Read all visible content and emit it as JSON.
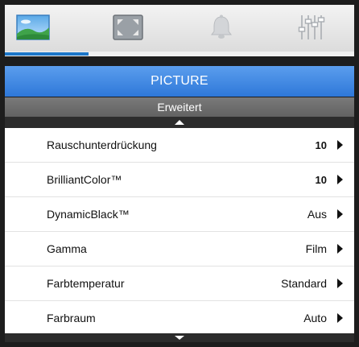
{
  "tabs": [
    {
      "icon": "picture-icon",
      "selected": true
    },
    {
      "icon": "display-icon",
      "selected": false
    },
    {
      "icon": "bell-icon",
      "selected": false
    },
    {
      "icon": "settings-sliders-icon",
      "selected": false
    }
  ],
  "progress": {
    "fraction": 0.24
  },
  "header": {
    "title": "PICTURE",
    "subtitle": "Erweitert"
  },
  "menu": {
    "items": [
      {
        "label": "Rauschunterdrückung",
        "value": "10"
      },
      {
        "label": "BrilliantColor™",
        "value": "10"
      },
      {
        "label": "DynamicBlack™",
        "value": "Aus"
      },
      {
        "label": "Gamma",
        "value": "Film"
      },
      {
        "label": "Farbtemperatur",
        "value": "Standard"
      },
      {
        "label": "Farbraum",
        "value": "Auto"
      }
    ]
  },
  "colors": {
    "title_bar": "#3b86e0",
    "subtitle_bar": "#6e6e6e",
    "frame": "#1d1d1d",
    "progress": "#1c76c8"
  }
}
